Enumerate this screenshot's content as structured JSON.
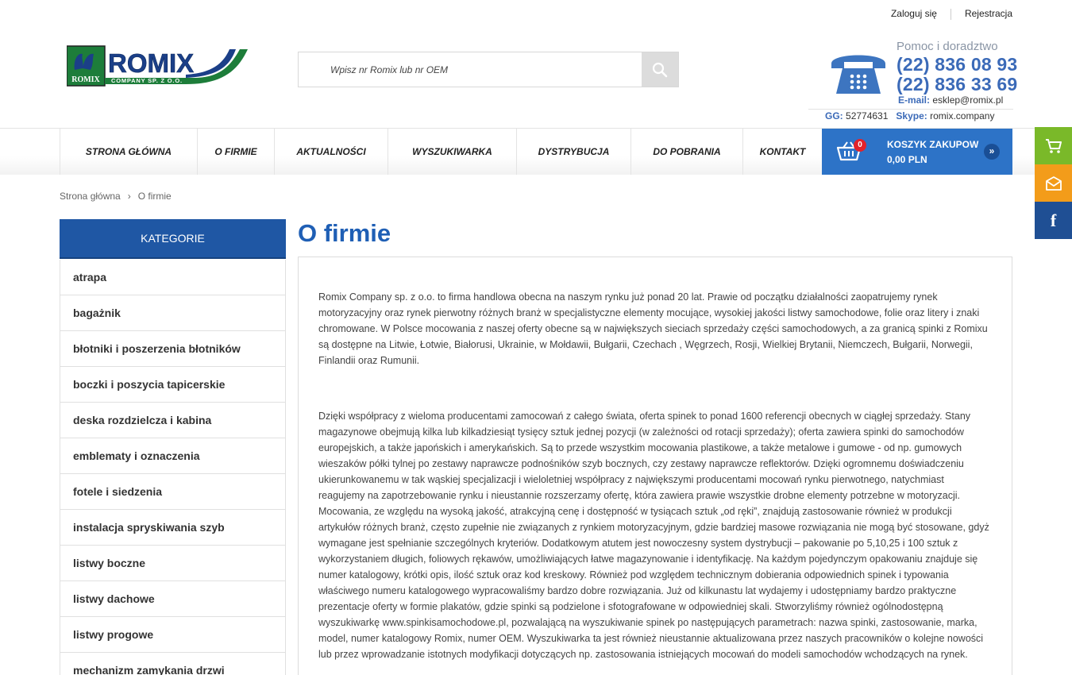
{
  "top_links": {
    "login": "Zaloguj się",
    "register": "Rejestracja"
  },
  "logo": {
    "text": "ROMIX",
    "subtitle": "COMPANY SP. Z O.O.",
    "emblem_text": "ROMIX"
  },
  "search": {
    "placeholder": "Wpisz nr Romix lub nr OEM",
    "value": ""
  },
  "contact": {
    "help": "Pomoc i doradztwo",
    "phone1": "(22) 836 08 93",
    "phone2": "(22) 836 33 69",
    "email_label": "E-mail:",
    "email": "esklep@romix.pl",
    "gg_label": "GG:",
    "gg": "52774631",
    "skype_label": "Skype:",
    "skype": "romix.company"
  },
  "nav": {
    "items": [
      {
        "label": "STRONA GŁÓWNA"
      },
      {
        "label": "O FIRMIE"
      },
      {
        "label": "AKTUALNOŚCI"
      },
      {
        "label": "WYSZUKIWARKA"
      },
      {
        "label": "DYSTRYBUCJA"
      },
      {
        "label": "DO POBRANIA"
      },
      {
        "label": "KONTAKT"
      }
    ]
  },
  "cart": {
    "count": "0",
    "label": "KOSZYK ZAKUPOW",
    "total": "0,00 PLN",
    "go": "»"
  },
  "side_widgets": {
    "cart_color": "#7ab929",
    "mail_color": "#f39c1a",
    "facebook_color": "#1f4f94",
    "facebook_glyph": "f"
  },
  "breadcrumb": {
    "home": "Strona główna",
    "sep": "›",
    "current": "O firmie"
  },
  "categories": {
    "heading": "KATEGORIE",
    "items": [
      "atrapa",
      "bagażnik",
      "błotniki i poszerzenia błotników",
      "boczki i poszycia tapicerskie",
      "deska rozdzielcza i kabina",
      "emblematy i oznaczenia",
      "fotele i siedzenia",
      "instalacja spryskiwania szyb",
      "listwy boczne",
      "listwy dachowe",
      "listwy progowe",
      "mechanizm zamykania drzwi"
    ]
  },
  "page": {
    "title": "O firmie",
    "paragraphs": [
      "Romix Company sp. z o.o. to firma handlowa obecna na naszym rynku już ponad 20 lat. Prawie od początku działalności zaopatrujemy rynek motoryzacyjny oraz rynek pierwotny różnych branż w specjalistyczne elementy mocujące, wysokiej jakości listwy samochodowe, folie oraz litery i znaki chromowane. W Polsce mocowania z naszej oferty obecne są w największych sieciach sprzedaży części samochodowych, a za granicą spinki z Romixu są dostępne na Litwie, Łotwie, Białorusi, Ukrainie, w Mołdawii, Bułgarii, Czechach , Węgrzech, Rosji, Wielkiej Brytanii, Niemczech, Bułgarii, Norwegii, Finlandii oraz Rumunii.",
      "Dzięki współpracy z wieloma producentami zamocowań z całego świata, oferta spinek to ponad 1600 referencji obecnych w ciągłej sprzedaży. Stany magazynowe obejmują kilka lub kilkadziesiąt tysięcy sztuk jednej pozycji (w zależności od rotacji sprzedaży); oferta zawiera spinki do samochodów europejskich, a także japońskich i amerykańskich. Są to przede wszystkim mocowania plastikowe, a także metalowe i gumowe - od np. gumowych wieszaków półki tylnej po zestawy naprawcze podnośników szyb bocznych, czy zestawy naprawcze reflektorów. Dzięki ogromnemu doświadczeniu ukierunkowanemu w tak wąskiej specjalizacji i wieloletniej współpracy z największymi producentami mocowań rynku pierwotnego, natychmiast reagujemy na zapotrzebowanie rynku i nieustannie rozszerzamy ofertę, która zawiera prawie wszystkie drobne elementy potrzebne w motoryzacji. Mocowania, ze względu na wysoką jakość, atrakcyjną cenę i dostępność w tysiącach sztuk „od ręki”, znajdują zastosowanie również w produkcji artykułów różnych branż, często zupełnie nie związanych z rynkiem motoryzacyjnym, gdzie bardziej masowe rozwiązania nie mogą być stosowane, gdyż wymagane jest spełnianie szczególnych kryteriów. Dodatkowym atutem jest nowoczesny system dystrybucji – pakowanie po 5,10,25 i 100 sztuk z wykorzystaniem długich, foliowych rękawów, umożliwiających łatwe magazynowanie i identyfikację. Na każdym pojedynczym opakowaniu znajduje się numer katalogowy, krótki opis, ilość sztuk oraz kod kreskowy. Również pod względem technicznym dobierania odpowiednich spinek i typowania właściwego numeru katalogowego wypracowaliśmy bardzo dobre rozwiązania. Już od kilkunastu lat wydajemy i udostępniamy bardzo praktyczne prezentacje oferty w formie plakatów, gdzie spinki są podzielone i sfotografowane w odpowiedniej skali. Stworzyliśmy również ogólnodostępną wyszukiwarkę www.spinkisamochodowe.pl, pozwalającą na wyszukiwanie spinek po następujących parametrach: nazwa spinki, zastosowanie, marka, model, numer katalogowy Romix, numer OEM. Wyszukiwarka ta jest również nieustannie aktualizowana przez naszych pracowników o kolejne nowości lub przez wprowadzanie istotnych modyfikacji dotyczących np. zastosowania istniejących mocowań do modeli samochodów wchodzących na rynek."
    ]
  },
  "colors": {
    "brand_blue": "#1f57a4",
    "accent_blue": "#2d73c7",
    "title_blue": "#1f5fb5",
    "badge_red": "#e2232a"
  }
}
